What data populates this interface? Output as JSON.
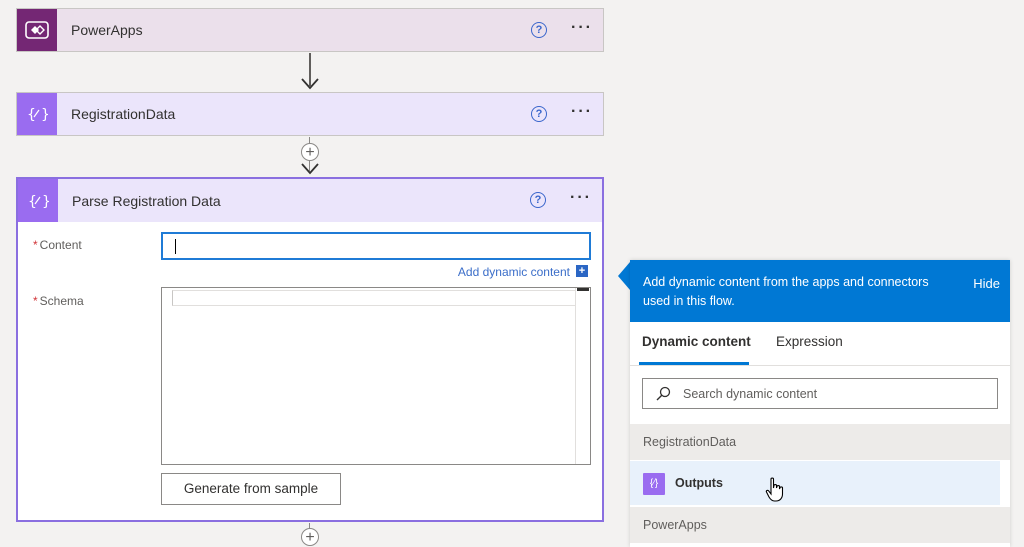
{
  "colors": {
    "powerapps_header": "#ebe0eb",
    "powerapps_icon": "#742774",
    "variable_header": "#ebe5fb",
    "variable_icon": "#9a6cf0",
    "accent_blue": "#0078d4"
  },
  "steps": [
    {
      "title": "PowerApps",
      "icon": "powerapps-icon"
    },
    {
      "title": "RegistrationData",
      "icon": "variable-icon"
    },
    {
      "title": "Parse Registration Data",
      "icon": "variable-icon"
    }
  ],
  "help_glyph": "?",
  "more_glyph": "···",
  "plus_glyph": "+",
  "parse_step": {
    "content_label": "Content",
    "schema_label": "Schema",
    "required_marker": "*",
    "add_dynamic_label": "Add dynamic content",
    "add_dynamic_plus": "+",
    "generate_label": "Generate from sample"
  },
  "panel": {
    "header_text": "Add dynamic content from the apps and connectors used in this flow.",
    "hide_label": "Hide",
    "tabs": [
      {
        "label": "Dynamic content",
        "active": true
      },
      {
        "label": "Expression",
        "active": false
      }
    ],
    "search_placeholder": "Search dynamic content",
    "groups": [
      {
        "name": "RegistrationData",
        "items": [
          {
            "label": "Outputs",
            "icon": "variable-icon",
            "icon_glyph": "{⁄}"
          }
        ]
      },
      {
        "name": "PowerApps",
        "items": []
      }
    ]
  }
}
